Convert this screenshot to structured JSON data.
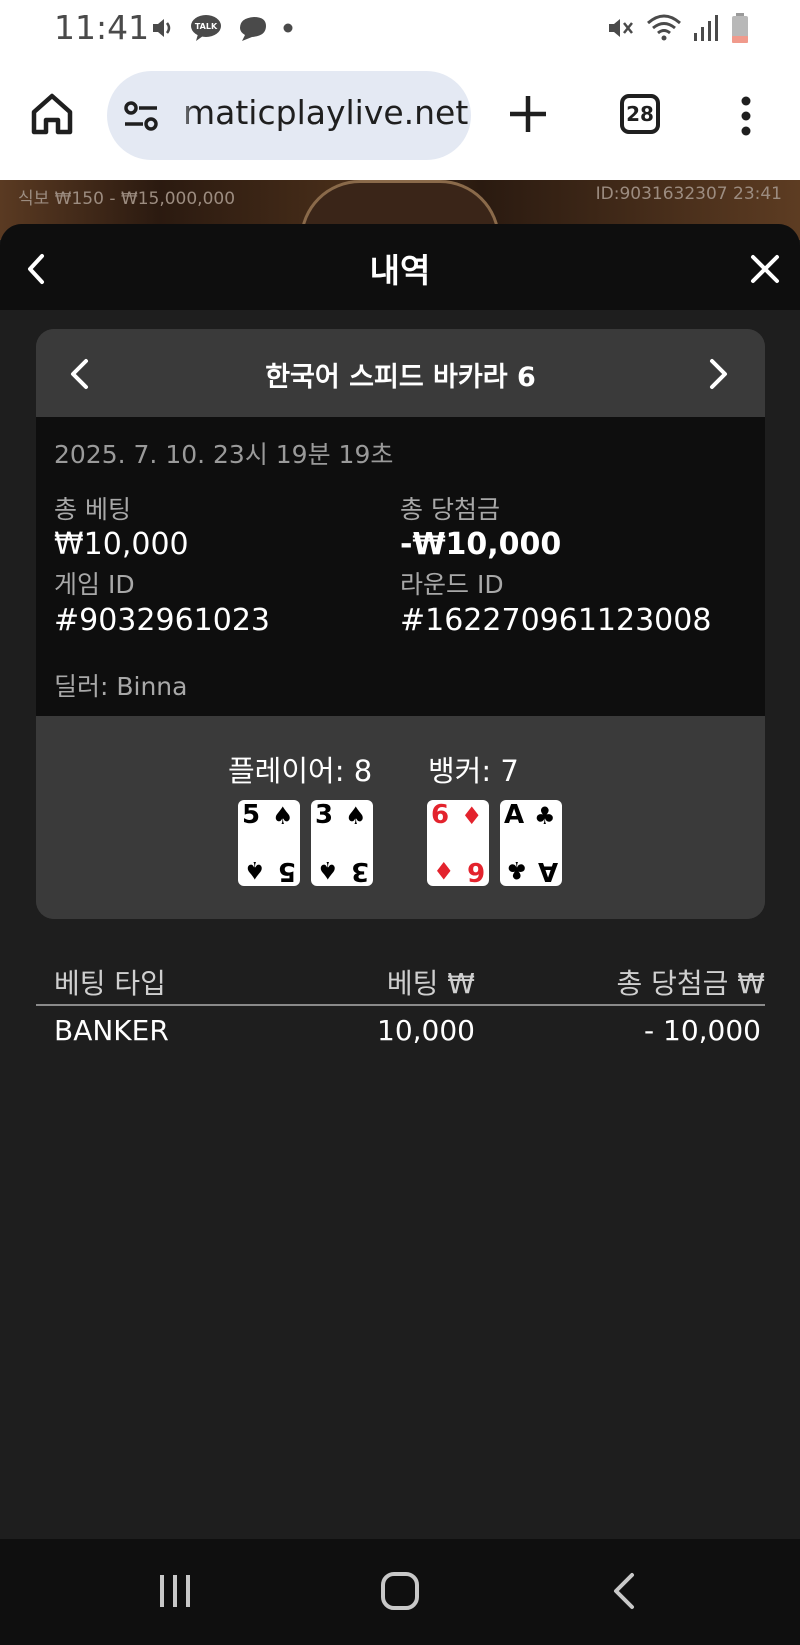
{
  "status_bar": {
    "time": "11:41",
    "left_icons": [
      "volume-icon",
      "talk-icon",
      "chat-bubble-icon",
      "dot-icon"
    ],
    "right_icons": [
      "mute-icon",
      "wifi-icon",
      "signal-icon",
      "battery-icon"
    ],
    "talk_badge": "TALK"
  },
  "browser": {
    "url": "maticplaylive.net",
    "tab_count": "28"
  },
  "game_strip": {
    "limits": "식보 ₩150 - ₩15,000,000",
    "round_info": "ID:9031632307 23:41"
  },
  "sheet": {
    "title": "내역"
  },
  "card": {
    "game_title": "한국어 스피드 바카라 6",
    "datetime": "2025. 7. 10. 23시 19분 19초",
    "total_bet_label": "총 베팅",
    "total_bet_value": "₩10,000",
    "total_win_label": "총 당첨금",
    "total_win_value": "-₩10,000",
    "game_id_label": "게임 ID",
    "game_id_value": "#9032961023",
    "round_id_label": "라운드 ID",
    "round_id_value": "#162270961123008",
    "dealer": "딜러: Binna"
  },
  "result": {
    "player_label": "플레이어: 8",
    "banker_label": "뱅커: 7",
    "player_cards": [
      {
        "rank": "5",
        "suit": "♠",
        "color": "#000000"
      },
      {
        "rank": "3",
        "suit": "♠",
        "color": "#000000"
      }
    ],
    "banker_cards": [
      {
        "rank": "6",
        "suit": "♦",
        "color": "#e3232d"
      },
      {
        "rank": "A",
        "suit": "♣",
        "color": "#000000"
      }
    ]
  },
  "table": {
    "headers": [
      "베팅 타입",
      "베팅 ₩",
      "총 당첨금 ₩"
    ],
    "rows": [
      {
        "type": "BANKER",
        "bet": "10,000",
        "win": "- 10,000"
      }
    ]
  },
  "nav_bar": {
    "icons": [
      "recent-apps-icon",
      "home-icon",
      "back-icon"
    ]
  }
}
